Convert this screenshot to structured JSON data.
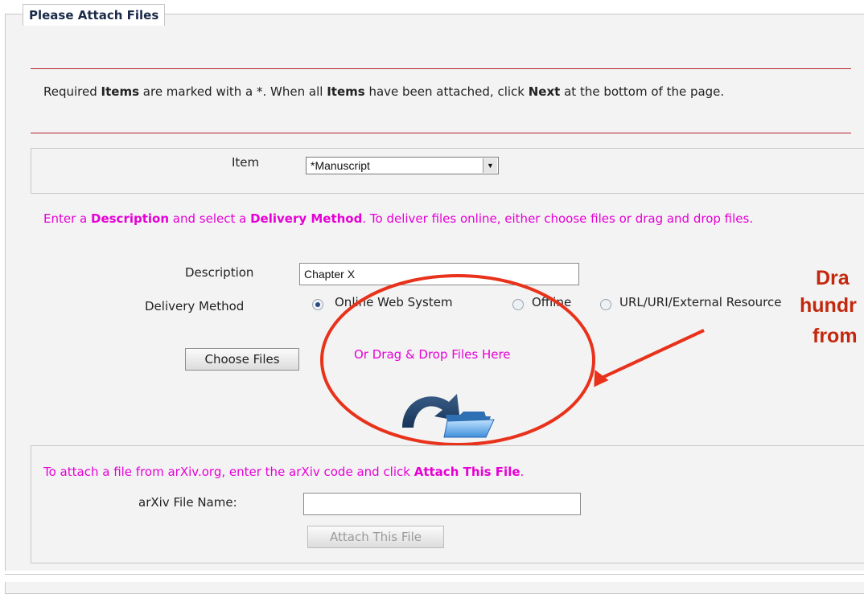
{
  "legend": "Please Attach Files",
  "instructions": {
    "p1": "Required ",
    "b1": "Items",
    "p2": " are marked with a *. When all ",
    "b2": "Items",
    "p3": " have been attached, click ",
    "b3": "Next",
    "p4": " at the bottom of the page."
  },
  "item": {
    "label": "Item",
    "selected": "*Manuscript"
  },
  "delivery_instructions": {
    "p1": "Enter a ",
    "b1": "Description",
    "p2": " and select a ",
    "b2": "Delivery Method",
    "p3": ". To deliver files online, either choose files or drag and drop files."
  },
  "description": {
    "label": "Description",
    "value": "Chapter X"
  },
  "delivery": {
    "label": "Delivery Method",
    "options": [
      "Online Web System",
      "Offline",
      "URL/URI/External Resource"
    ],
    "selected": "Online Web System"
  },
  "choose_files_button": "Choose Files",
  "drop_zone_label": "Or Drag & Drop Files Here",
  "arxiv": {
    "p1": "To attach a file from arXiv.org, enter the arXiv code and click ",
    "b1": "Attach This File",
    "p2": ".",
    "field_label": "arXiv File Name:",
    "field_value": "",
    "button": "Attach This File"
  },
  "callout": {
    "line1": "Dra",
    "line2": "hundr",
    "line3": "from"
  },
  "colors": {
    "accent_red": "#b32227",
    "instruction_magenta": "#e600d6",
    "callout_red": "#e8321b"
  },
  "icons": [
    "select-arrow-icon",
    "drag-drop-folder-icon"
  ]
}
